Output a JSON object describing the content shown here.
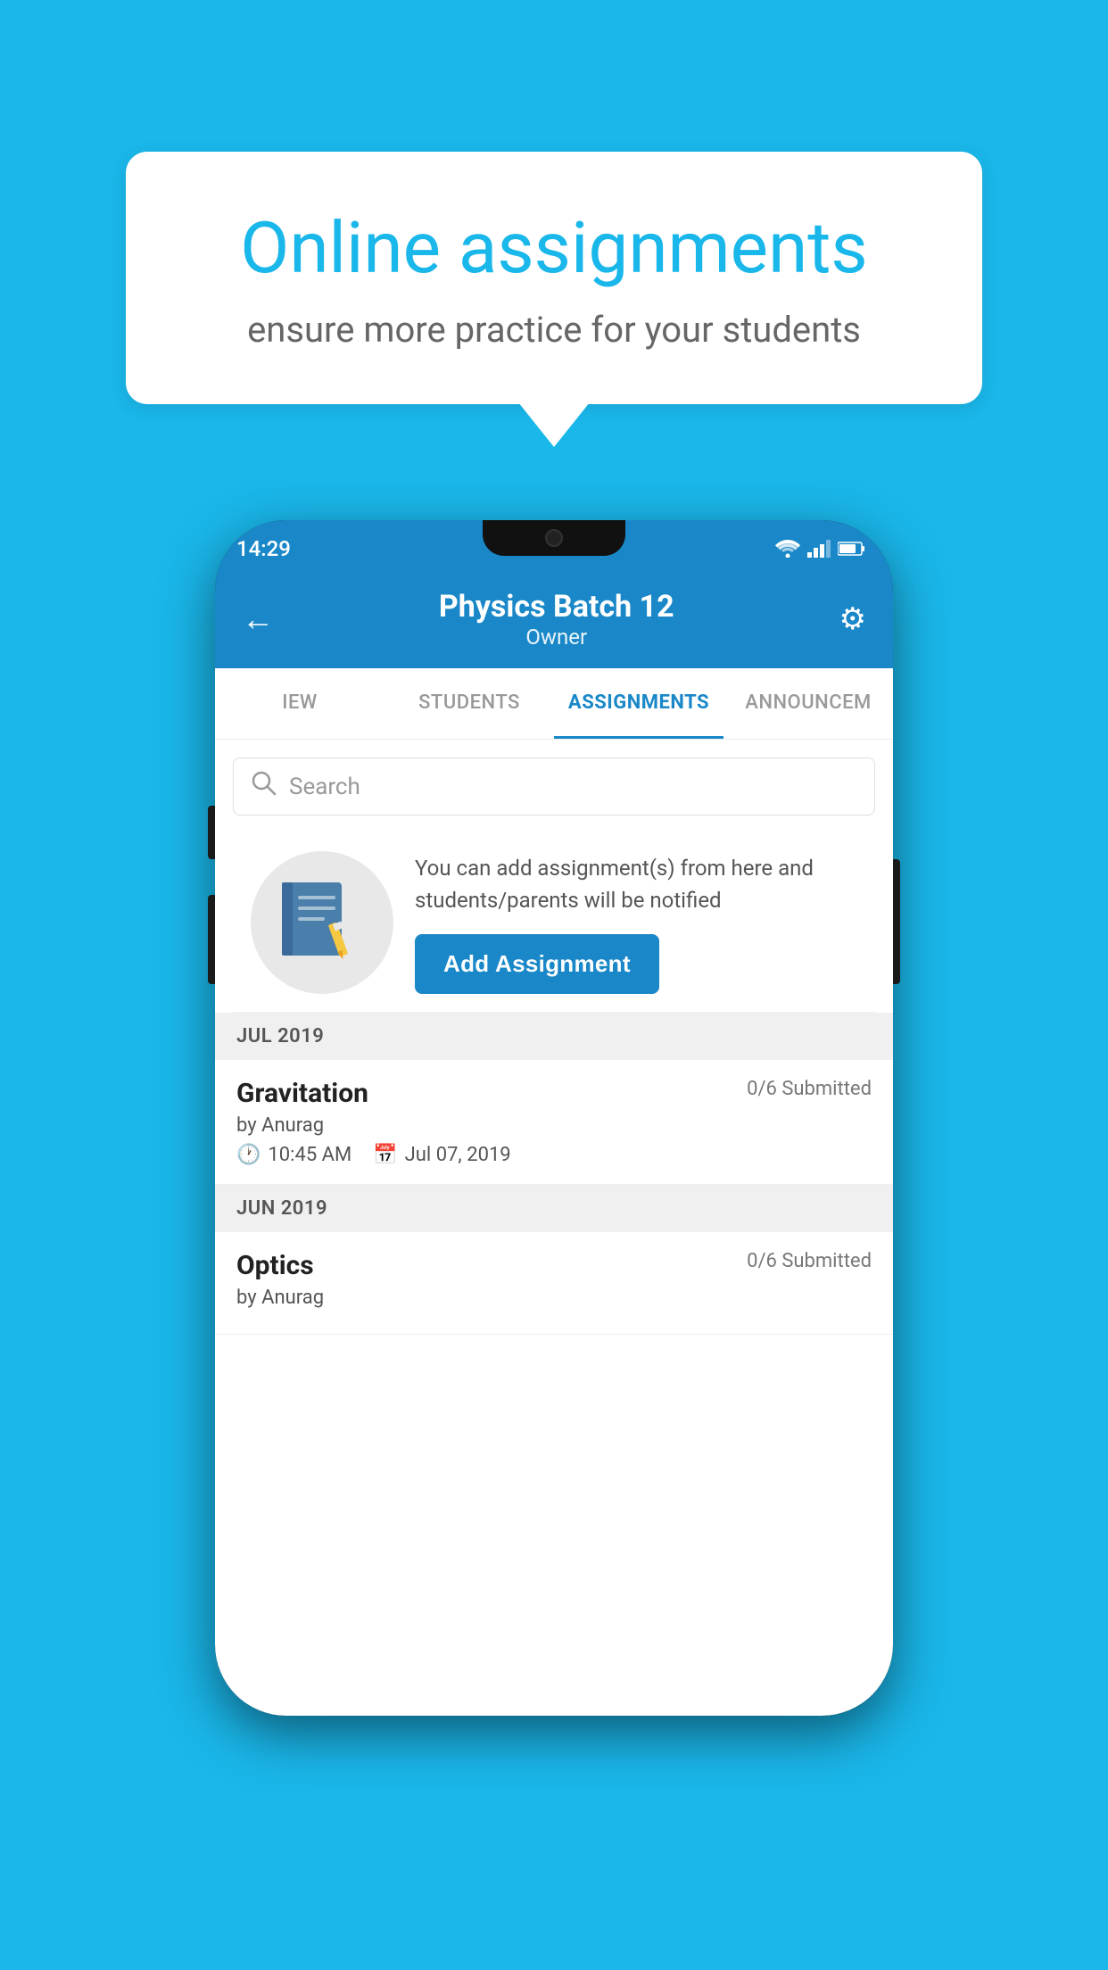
{
  "background_color": "#1ab7ea",
  "speech_bubble": {
    "title": "Online assignments",
    "subtitle": "ensure more practice for your students"
  },
  "phone": {
    "status_bar": {
      "time": "14:29",
      "icons": [
        "wifi",
        "signal",
        "battery"
      ]
    },
    "header": {
      "title": "Physics Batch 12",
      "subtitle": "Owner",
      "back_label": "←",
      "settings_label": "⚙"
    },
    "tabs": [
      {
        "label": "IEW",
        "active": false
      },
      {
        "label": "STUDENTS",
        "active": false
      },
      {
        "label": "ASSIGNMENTS",
        "active": true
      },
      {
        "label": "ANNOUNCEM",
        "active": false
      }
    ],
    "search": {
      "placeholder": "Search"
    },
    "empty_state": {
      "description": "You can add assignment(s) from here and students/parents will be notified",
      "add_button_label": "Add Assignment"
    },
    "sections": [
      {
        "header": "JUL 2019",
        "assignments": [
          {
            "name": "Gravitation",
            "submitted": "0/6 Submitted",
            "by": "by Anurag",
            "time": "10:45 AM",
            "date": "Jul 07, 2019"
          }
        ]
      },
      {
        "header": "JUN 2019",
        "assignments": [
          {
            "name": "Optics",
            "submitted": "0/6 Submitted",
            "by": "by Anurag",
            "time": "",
            "date": ""
          }
        ]
      }
    ]
  }
}
